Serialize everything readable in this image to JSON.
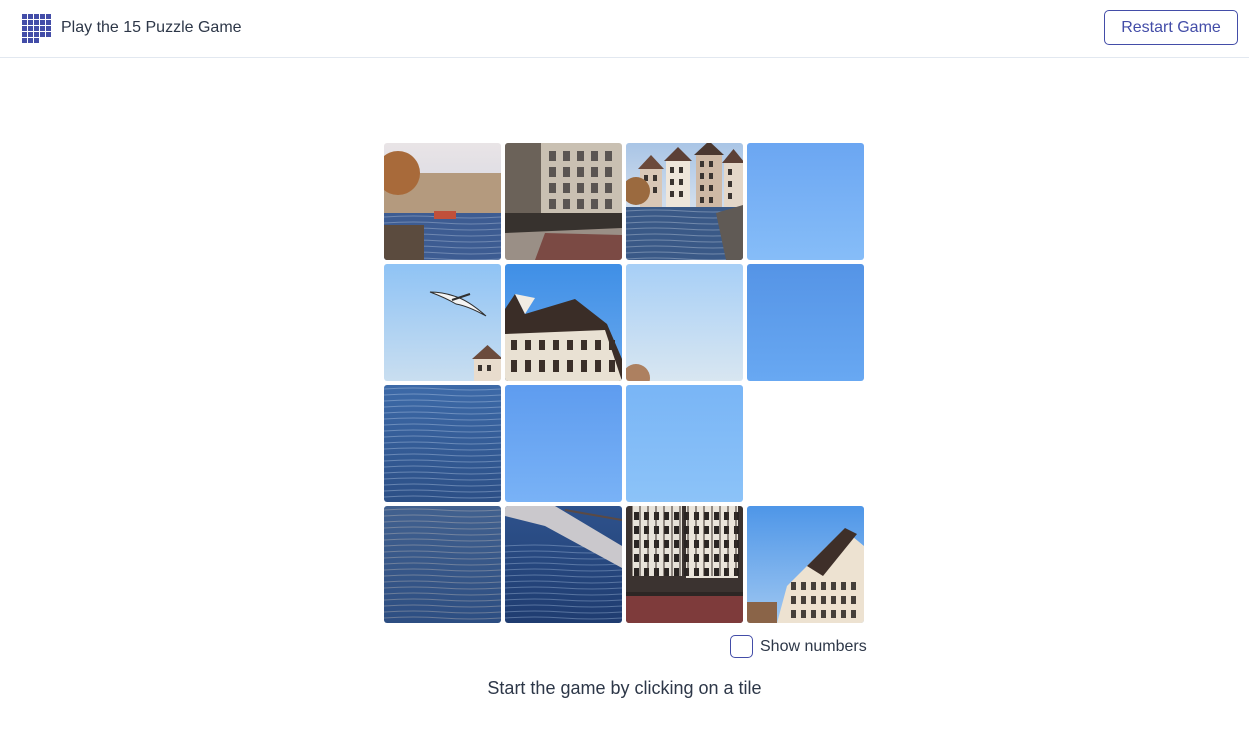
{
  "header": {
    "title": "Play the 15 Puzzle Game",
    "logo_icon": "grid-puzzle-icon",
    "restart_label": "Restart Game"
  },
  "board": {
    "rows": 4,
    "cols": 4,
    "empty_position": [
      2,
      3
    ],
    "tiles": [
      {
        "row": 0,
        "col": 0,
        "scene": "canal-boats"
      },
      {
        "row": 0,
        "col": 1,
        "scene": "building-promenade"
      },
      {
        "row": 0,
        "col": 2,
        "scene": "canal-houses"
      },
      {
        "row": 0,
        "col": 3,
        "scene": "sky"
      },
      {
        "row": 1,
        "col": 0,
        "scene": "seagull-sky"
      },
      {
        "row": 1,
        "col": 1,
        "scene": "timber-roof"
      },
      {
        "row": 1,
        "col": 2,
        "scene": "sky-tree"
      },
      {
        "row": 1,
        "col": 3,
        "scene": "sky-deep"
      },
      {
        "row": 2,
        "col": 0,
        "scene": "water"
      },
      {
        "row": 2,
        "col": 1,
        "scene": "sky-mid"
      },
      {
        "row": 2,
        "col": 2,
        "scene": "sky-light"
      },
      {
        "row": 3,
        "col": 0,
        "scene": "water-dark"
      },
      {
        "row": 3,
        "col": 1,
        "scene": "water-quay"
      },
      {
        "row": 3,
        "col": 2,
        "scene": "timber-houses"
      },
      {
        "row": 3,
        "col": 3,
        "scene": "gabled-houses"
      }
    ]
  },
  "controls": {
    "show_numbers_label": "Show numbers",
    "show_numbers_checked": false
  },
  "status": {
    "message": "Start the game by clicking on a tile"
  },
  "colors": {
    "accent": "#434da8",
    "text": "#2d3748",
    "border": "#e2e8f0"
  }
}
